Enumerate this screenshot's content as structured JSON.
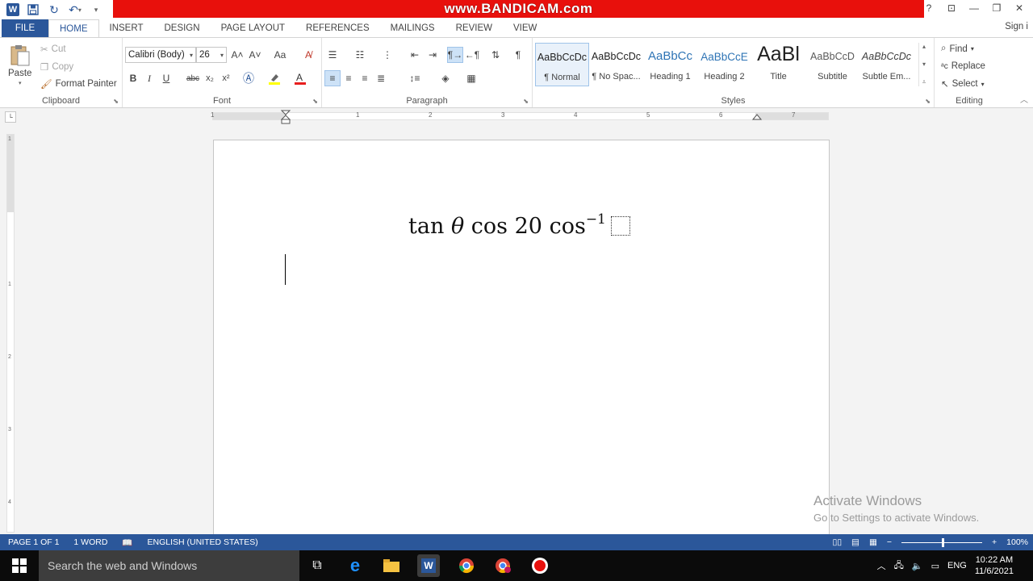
{
  "window": {
    "watermark": "www.BANDICAM.com",
    "help": "?",
    "signin": "Sign i"
  },
  "tabs": [
    "FILE",
    "HOME",
    "INSERT",
    "DESIGN",
    "PAGE LAYOUT",
    "REFERENCES",
    "MAILINGS",
    "REVIEW",
    "VIEW"
  ],
  "clipboard": {
    "paste": "Paste",
    "cut": "Cut",
    "copy": "Copy",
    "format_painter": "Format Painter",
    "label": "Clipboard"
  },
  "font": {
    "name": "Calibri (Body)",
    "size": "26",
    "bold": "B",
    "italic": "I",
    "underline": "U",
    "strikethrough": "abc",
    "subscript": "x₂",
    "superscript": "x²",
    "change_case": "Aa",
    "grow": "A˄",
    "shrink": "A˅",
    "label": "Font"
  },
  "paragraph": {
    "label": "Paragraph"
  },
  "styles": {
    "label": "Styles",
    "items": [
      {
        "sample": "AaBbCcDc",
        "name": "¶ Normal"
      },
      {
        "sample": "AaBbCcDc",
        "name": "¶ No Spac..."
      },
      {
        "sample": "AaBbCc",
        "name": "Heading 1"
      },
      {
        "sample": "AaBbCcE",
        "name": "Heading 2"
      },
      {
        "sample": "AaBl",
        "name": "Title"
      },
      {
        "sample": "AaBbCcD",
        "name": "Subtitle"
      },
      {
        "sample": "AaBbCcDc",
        "name": "Subtle Em..."
      }
    ]
  },
  "editing": {
    "find": "Find",
    "replace": "Replace",
    "select": "Select",
    "label": "Editing"
  },
  "ruler": {
    "numbers": [
      "1",
      "1",
      "2",
      "3",
      "4",
      "5",
      "6",
      "7"
    ]
  },
  "vruler": {
    "numbers": [
      "1",
      "1",
      "2",
      "3",
      "4"
    ]
  },
  "document": {
    "eq_tan": "tan",
    "eq_theta": "θ",
    "eq_cos1": "cos",
    "eq_num": "20",
    "eq_cos2": "cos",
    "eq_sup": "−1"
  },
  "activation": {
    "title": "Activate Windows",
    "subtitle": "Go to Settings to activate Windows."
  },
  "status": {
    "page": "PAGE 1 OF 1",
    "words": "1 WORD",
    "language": "ENGLISH (UNITED STATES)",
    "zoom": "100%"
  },
  "taskbar": {
    "search_placeholder": "Search the web and Windows",
    "lang": "ENG",
    "time": "10:22 AM",
    "date": "11/6/2021"
  },
  "colors": {
    "word_blue": "#2b579a",
    "bandicam_red": "#e8100c"
  }
}
